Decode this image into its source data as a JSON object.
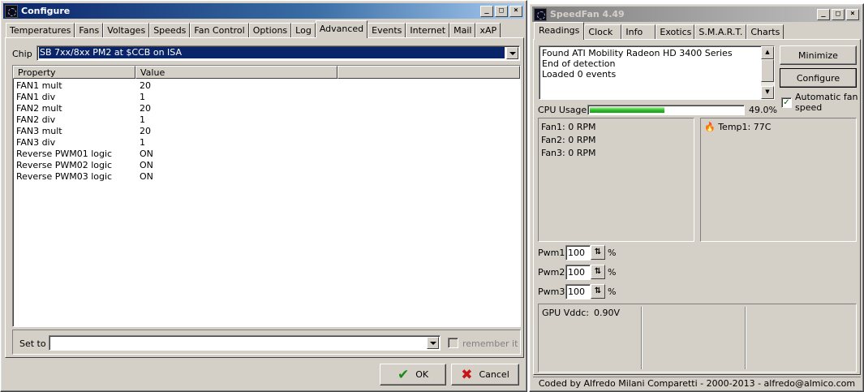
{
  "configure": {
    "title": "Configure",
    "tabs": [
      "Temperatures",
      "Fans",
      "Voltages",
      "Speeds",
      "Fan Control",
      "Options",
      "Log",
      "Advanced",
      "Events",
      "Internet",
      "Mail",
      "xAP"
    ],
    "active_tab": "Advanced",
    "chip_label": "Chip",
    "chip_value": "SB 7xx/8xx PM2 at $CCB on ISA",
    "columns": [
      "Property",
      "Value"
    ],
    "rows": [
      {
        "property": "FAN1 mult",
        "value": "20"
      },
      {
        "property": "FAN1 div",
        "value": "1"
      },
      {
        "property": "FAN2 mult",
        "value": "20"
      },
      {
        "property": "FAN2 div",
        "value": "1"
      },
      {
        "property": "FAN3 mult",
        "value": "20"
      },
      {
        "property": "FAN3 div",
        "value": "1"
      },
      {
        "property": "Reverse PWM01 logic",
        "value": "ON"
      },
      {
        "property": "Reverse PWM02 logic",
        "value": "ON"
      },
      {
        "property": "Reverse PWM03 logic",
        "value": "ON"
      }
    ],
    "set_to_label": "Set to",
    "set_to_value": "",
    "remember_label": "remember it",
    "ok_label": "OK",
    "cancel_label": "Cancel"
  },
  "speedfan": {
    "title": "SpeedFan 4.49",
    "tabs": [
      "Readings",
      "Clock",
      "Info",
      "Exotics",
      "S.M.A.R.T.",
      "Charts"
    ],
    "active_tab": "Readings",
    "log_lines": [
      "Found ATI Mobility Radeon HD 3400 Series",
      "End of detection",
      "Loaded 0 events"
    ],
    "minimize_label": "Minimize",
    "configure_label": "Configure",
    "auto_fan_label_1": "Automatic fan",
    "auto_fan_label_2": "speed",
    "auto_fan_checked": true,
    "cpu_usage_label": "CPU Usage",
    "cpu_usage_value": "49.0%",
    "cpu_usage_fraction": 0.49,
    "fans": [
      "Fan1: 0 RPM",
      "Fan2: 0 RPM",
      "Fan3: 0 RPM"
    ],
    "temps": [
      "Temp1: 77C"
    ],
    "pwm": [
      {
        "label": "Pwm1:",
        "value": "100",
        "unit": "%"
      },
      {
        "label": "Pwm2:",
        "value": "100",
        "unit": "%"
      },
      {
        "label": "Pwm3:",
        "value": "100",
        "unit": "%"
      }
    ],
    "gpu_vddc_label": "GPU Vddc:",
    "gpu_vddc_value": "0.90V",
    "status_text": "Coded by Alfredo Milani Comparetti - 2000-2013 - alfredo@almico.com"
  },
  "colors": {
    "title_active": "#0a246a",
    "progress_green": "#2fc12f",
    "selection": "#0a246a"
  }
}
